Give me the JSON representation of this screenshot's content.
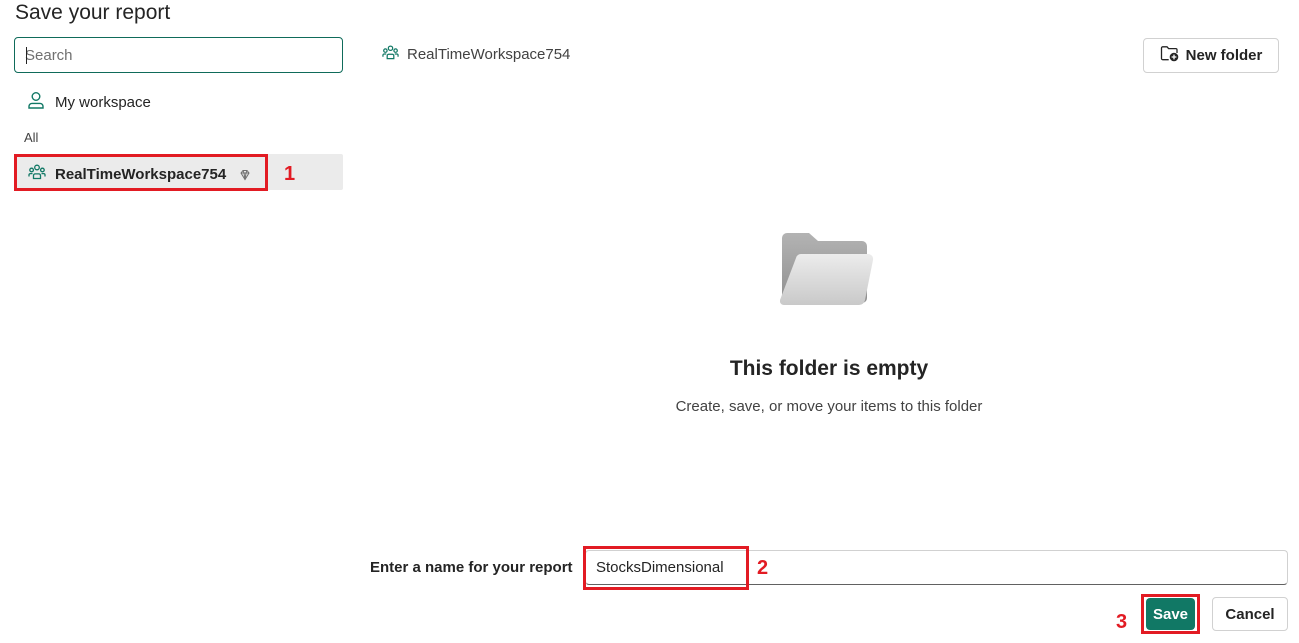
{
  "dialog": {
    "title": "Save your report"
  },
  "left": {
    "search": {
      "placeholder": "Search",
      "value": ""
    },
    "my_workspace": {
      "label": "My workspace",
      "icon": "person-icon"
    },
    "section_label": "All",
    "workspaces": [
      {
        "label": "RealTimeWorkspace754",
        "icon": "people-team-icon",
        "badge_icon": "premium-diamond-icon",
        "selected": true
      }
    ]
  },
  "right": {
    "breadcrumb": {
      "label": "RealTimeWorkspace754",
      "icon": "people-team-icon"
    },
    "new_folder": {
      "label": "New folder",
      "icon": "folder-add-icon"
    },
    "empty_state": {
      "icon": "empty-folder-icon",
      "title": "This folder is empty",
      "subtitle": "Create, save, or move your items to this folder"
    },
    "name_field": {
      "label": "Enter a name for your report",
      "value": "StocksDimensional"
    },
    "actions": {
      "save_label": "Save",
      "cancel_label": "Cancel"
    }
  },
  "annotations": {
    "step1": "1",
    "step2": "2",
    "step3": "3",
    "color": "#e21b23"
  },
  "theme": {
    "accent": "#117865",
    "focus_border": "#0f6b5a",
    "selected_row_bg": "#ebebeb"
  }
}
